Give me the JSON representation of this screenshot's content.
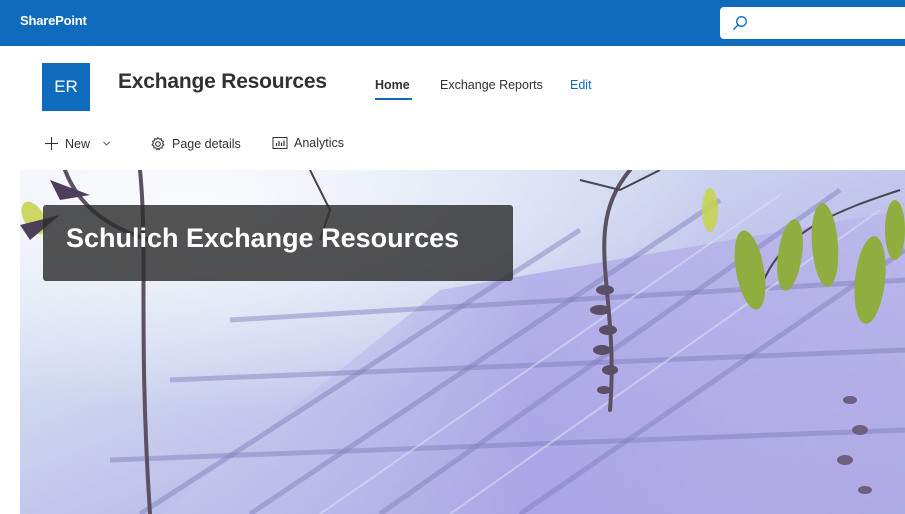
{
  "suitebar": {
    "app_name": "SharePoint",
    "search_placeholder": "",
    "search_icon": "search-icon"
  },
  "site": {
    "logo_initials": "ER",
    "title": "Exchange Resources"
  },
  "nav": {
    "items": [
      {
        "label": "Home",
        "active": true
      },
      {
        "label": "Exchange Reports",
        "active": false
      },
      {
        "label": "Edit",
        "active": false
      }
    ]
  },
  "commandbar": {
    "new_label": "New",
    "new_icon": "plus-icon",
    "page_details_label": "Page details",
    "page_details_icon": "gear-icon",
    "analytics_label": "Analytics",
    "analytics_icon": "analytics-icon"
  },
  "hero": {
    "title": "Schulich Exchange Resources"
  },
  "colors": {
    "brand": "#0f6cbd",
    "text": "#323130",
    "hero_title_bg": "#2d2d2d"
  }
}
